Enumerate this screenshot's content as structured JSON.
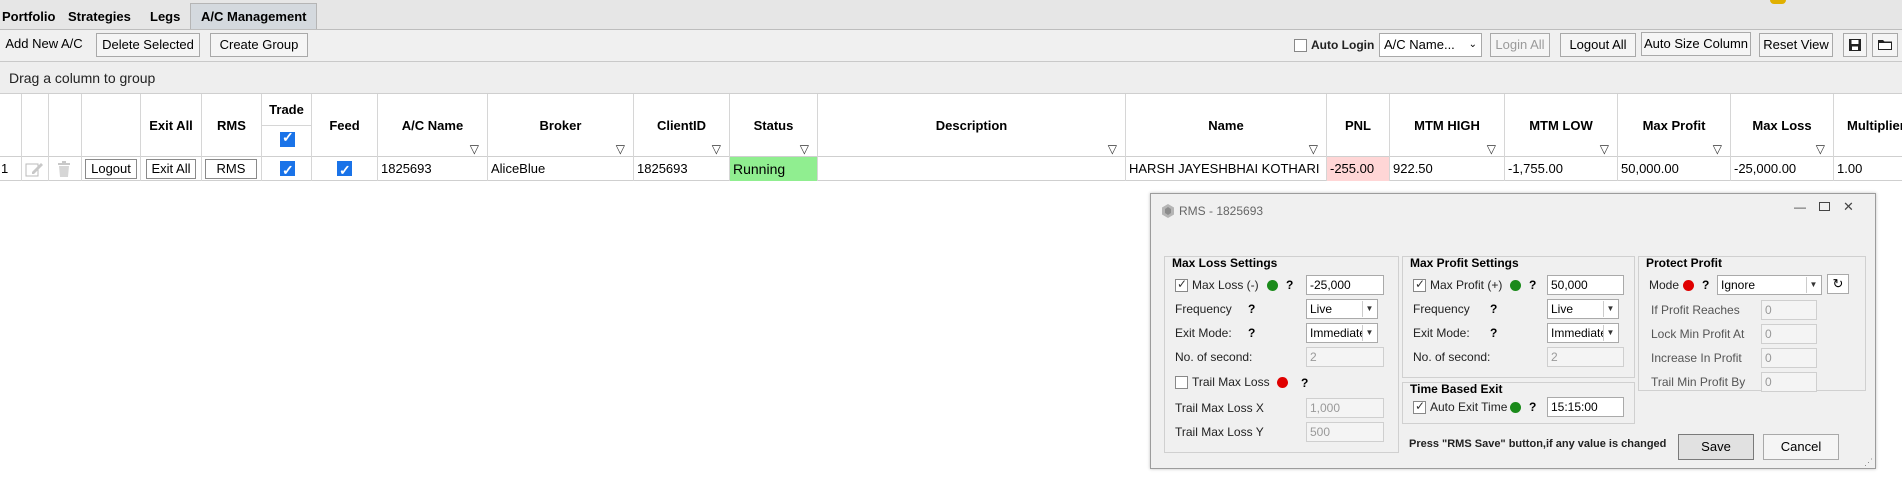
{
  "tabs": [
    "Portfolio",
    "Strategies",
    "Legs",
    "A/C Management"
  ],
  "toolbar": {
    "add_new": "Add  New A/C",
    "delete_selected": "Delete Selected",
    "create_group": "Create Group",
    "auto_login": "Auto Login",
    "ac_name_select": "A/C Name...",
    "login_all": "Login All",
    "logout_all": "Logout All",
    "auto_size": "Auto Size Column",
    "reset_view": "Reset View"
  },
  "groupbar": {
    "text": "Drag a column to group"
  },
  "columns": {
    "exit_all": "Exit All",
    "rms": "RMS",
    "trade": "Trade",
    "feed": "Feed",
    "ac_name": "A/C Name",
    "broker": "Broker",
    "client_id": "ClientID",
    "status": "Status",
    "description": "Description",
    "name": "Name",
    "pnl": "PNL",
    "mtm_high": "MTM HIGH",
    "mtm_low": "MTM LOW",
    "max_profit": "Max Profit",
    "max_loss": "Max Loss",
    "multiplier": "Multiplier"
  },
  "row": {
    "index": "1",
    "logout": "Logout",
    "exit_all": "Exit All",
    "rms": "RMS",
    "ac_name": "1825693",
    "broker": "AliceBlue",
    "client_id": "1825693",
    "status": "Running",
    "description": "",
    "name": "HARSH JAYESHBHAI KOTHARI",
    "pnl": "-255.00",
    "mtm_high": "922.50",
    "mtm_low": "-1,755.00",
    "max_profit": "50,000.00",
    "max_loss": "-25,000.00",
    "multiplier": "1.00"
  },
  "rms": {
    "title": "RMS - 1825693",
    "max_loss": {
      "heading": "Max Loss Settings",
      "max_loss_label": "Max Loss (-)",
      "max_loss_value": "-25,000",
      "frequency_label": "Frequency",
      "frequency_value": "Live",
      "exit_mode_label": "Exit Mode:",
      "exit_mode_value": "Immediate",
      "seconds_label": "No. of second:",
      "seconds_value": "2",
      "trail_label": "Trail Max Loss",
      "trail_x_label": "Trail Max Loss X",
      "trail_x_value": "1,000",
      "trail_y_label": "Trail Max Loss Y",
      "trail_y_value": "500"
    },
    "max_profit": {
      "heading": "Max Profit Settings",
      "max_profit_label": "Max Profit (+)",
      "max_profit_value": "50,000",
      "frequency_label": "Frequency",
      "frequency_value": "Live",
      "exit_mode_label": "Exit Mode:",
      "exit_mode_value": "Immediate",
      "seconds_label": "No. of second:",
      "seconds_value": "2"
    },
    "time_exit": {
      "heading": "Time Based Exit",
      "label": "Auto Exit Time",
      "value": "15:15:00"
    },
    "protect": {
      "heading": "Protect Profit",
      "mode_label": "Mode",
      "mode_value": "Ignore",
      "reaches_label": "If Profit Reaches",
      "reaches_value": "0",
      "lock_label": "Lock Min Profit At",
      "lock_value": "0",
      "increase_label": "Increase In Profit",
      "increase_value": "0",
      "trail_label": "Trail Min Profit By",
      "trail_value": "0"
    },
    "note": "Press \"RMS Save\" button,if any value is changed",
    "save": "Save",
    "cancel": "Cancel"
  },
  "colors": {
    "status_bg": "#90ee90",
    "pnl_bg": "#ffd6d6",
    "green_dot": "#1a8a1a",
    "red_dot": "#e00000"
  }
}
